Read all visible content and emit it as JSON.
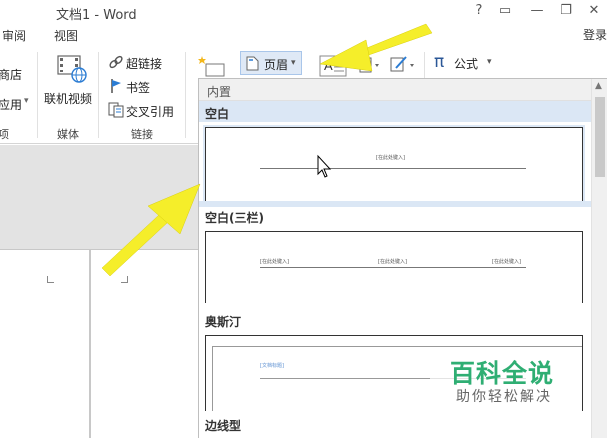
{
  "window": {
    "title": "文档1 - Word",
    "controls": {
      "help": "?",
      "ribbon_display": "▭",
      "minimize": "—",
      "restore": "❐",
      "close": "✕"
    }
  },
  "tabs": {
    "review": "审阅",
    "view": "视图",
    "login": "登录"
  },
  "ribbon": {
    "left_edge": {
      "store": "商店",
      "my_apps": "应用",
      "my_apps_arrow": "▾",
      "addins_group": "项"
    },
    "media": {
      "online_video": "联机视频",
      "group": "媒体"
    },
    "links": {
      "hyperlink": "超链接",
      "bookmark": "书签",
      "cross_reference": "交叉引用",
      "group": "链接"
    },
    "header_footer": {
      "header": "页眉",
      "header_arrow": "▾"
    },
    "symbols": {
      "equation": "公式",
      "equation_symbol": "π",
      "equation_arrow": "▾"
    }
  },
  "gallery": {
    "category": "内置",
    "items": [
      {
        "name": "空白",
        "placeholders": [
          "[在此处键入]"
        ]
      },
      {
        "name": "空白(三栏)",
        "placeholders": [
          "[在此处键入]",
          "[在此处键入]",
          "[在此处键入]"
        ]
      },
      {
        "name": "奥斯汀",
        "placeholders": [
          "[文档标题]"
        ]
      },
      {
        "name": "边线型",
        "placeholders": []
      }
    ],
    "scroll_up_glyph": "▲"
  },
  "watermark": {
    "title": "百科全说",
    "subtitle": "助你轻松解决"
  },
  "colors": {
    "arrow": "#f5ee2a",
    "watermark_green": "#2fae73",
    "selection": "#dbe7f5"
  }
}
